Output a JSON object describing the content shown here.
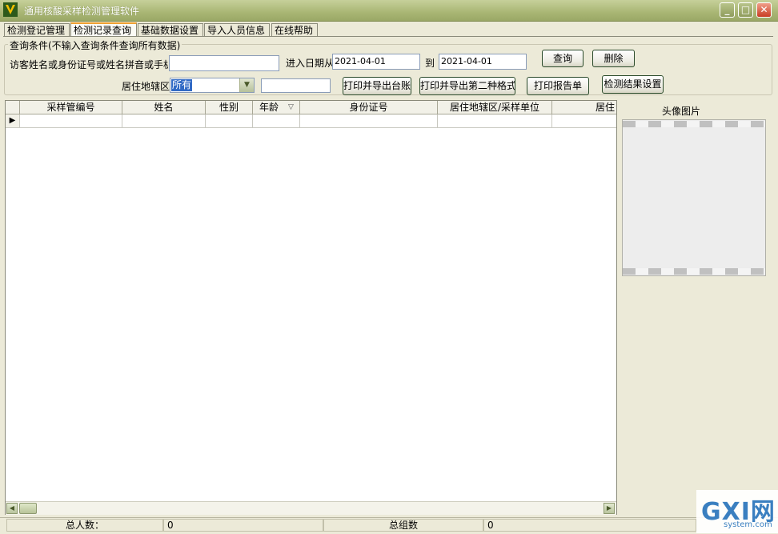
{
  "window": {
    "title": "通用核酸采样检测管理软件"
  },
  "tabs": [
    {
      "label": "检测登记管理"
    },
    {
      "label": "检测记录查询"
    },
    {
      "label": "基础数据设置"
    },
    {
      "label": "导入人员信息"
    },
    {
      "label": "在线帮助"
    }
  ],
  "query": {
    "group_label": "查询条件(不输入查询条件查询所有数据)",
    "search_label": "访客姓名或身份证号或姓名拼音或手机",
    "search_value": "",
    "date_from_label": "进入日期从",
    "date_from": "2021-04-01",
    "date_to_label": "到",
    "date_to": "2021-04-01",
    "district_label": "居住地辖区",
    "district_value": "所有",
    "extra_value": "",
    "buttons": {
      "search": "查询",
      "delete": "删除",
      "print_ledger": "打印并导出台账",
      "print_format2": "打印并导出第二种格式",
      "print_report": "打印报告单",
      "result_settings": "检测结果设置"
    }
  },
  "grid": {
    "columns": [
      "采样管编号",
      "姓名",
      "性别",
      "年龄",
      "身份证号",
      "居住地辖区/采样单位",
      "居住"
    ],
    "row_indicator": "▶"
  },
  "photo": {
    "label": "头像图片"
  },
  "status": {
    "total_people_label": "总人数：",
    "total_people": "0",
    "total_groups_label": "总组数",
    "total_groups": "0"
  },
  "watermark": {
    "brand": "GXI网",
    "site": "system.com"
  }
}
